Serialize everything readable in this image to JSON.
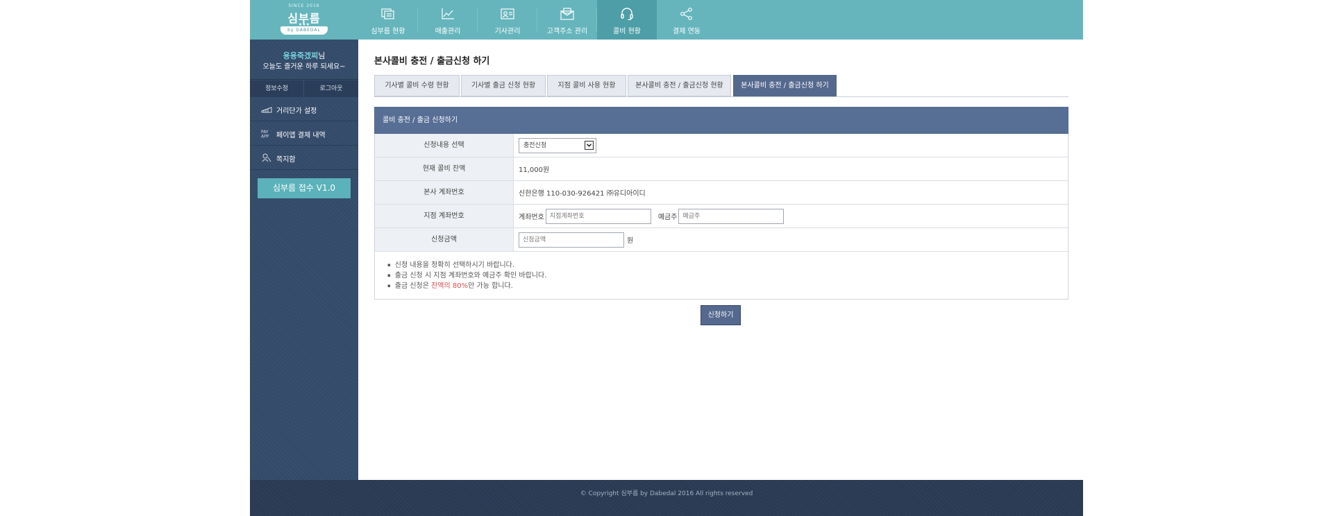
{
  "logo": {
    "since": "SINCE 2016",
    "name": "심부름",
    "stars": "★★★",
    "ribbon": "by DABEDAL"
  },
  "nav": [
    {
      "label": "심부름 현황",
      "icon": "list-icon"
    },
    {
      "label": "매출관리",
      "icon": "chart-icon"
    },
    {
      "label": "기사관리",
      "icon": "id-card-icon"
    },
    {
      "label": "고객주소 관리",
      "icon": "envelope-icon"
    },
    {
      "label": "콜비 현황",
      "icon": "headset-icon",
      "active": true
    },
    {
      "label": "결제 연동",
      "icon": "share-icon"
    }
  ],
  "sidebar": {
    "user_name": "용용죽겠찌",
    "user_suffix": "님",
    "greeting": "오늘도 즐거운 하루 되세요~",
    "account": {
      "edit_label": "정보수정",
      "logout_label": "로그아웃"
    },
    "menu": [
      {
        "label": "거리단가 설정",
        "icon": "ruler-icon"
      },
      {
        "label": "페이앱 결제 내역",
        "icon": "payapp-icon"
      },
      {
        "label": "쪽지함",
        "icon": "note-icon"
      }
    ],
    "version_label": "심부름 접수 V1.0"
  },
  "main": {
    "title": "본사콜비 충전 / 출금신청 하기",
    "tabs": [
      "기사별 콜비 수령 현황",
      "기사별 출금 신청 현황",
      "지점 콜비 사용 현황",
      "본사콜비 충전 / 출금신청 현황",
      "본사콜비 충전 / 출금신청 하기"
    ],
    "active_tab": 4,
    "panel_title": "콜비 충전 / 출금 신청하기",
    "form": {
      "type_label": "신청내용 선택",
      "type_value": "충전신청",
      "balance_label": "현재 콜비 잔액",
      "balance_value": "11,000원",
      "hq_account_label": "본사 계좌번호",
      "hq_account_value": "신한은행 110-030-926421 ㈜유디아이디",
      "branch_account_label": "지점 계좌번호",
      "account_no_label": "계좌번호",
      "account_no_placeholder": "지점계좌번호",
      "holder_label": "예금주",
      "holder_placeholder": "예금주",
      "amount_label": "신청금액",
      "amount_placeholder": "신청금액",
      "amount_unit": "원"
    },
    "notes": {
      "line1": "신청 내용을 정확히 선택하시기 바랍니다.",
      "line2": "출금 신청 시 지점 계좌번호와 예금주 확인 바랍니다.",
      "line3_prefix": "출금 신청은 ",
      "line3_highlight": "잔액의 80%",
      "line3_suffix": "만 가능 합니다."
    },
    "submit_label": "신청하기"
  },
  "footer": {
    "copyright": "© Copyright 심부름 by Dabedal 2016 All rights reserved"
  },
  "colors": {
    "header": "#66b5bd",
    "nav_active": "#4d9ea6",
    "sidebar": "#344b6b",
    "tab_active": "#55688e",
    "highlight": "#d94a4a"
  }
}
